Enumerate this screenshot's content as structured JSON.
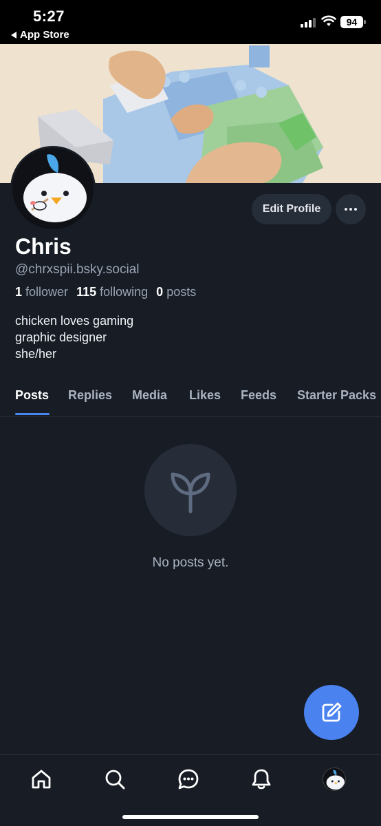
{
  "status_bar": {
    "time": "5:27",
    "back_label": "App Store",
    "battery": "94"
  },
  "profile": {
    "display_name": "Chris",
    "handle": "@chrxspii.bsky.social",
    "stats": {
      "followers_count": "1",
      "followers_label": "follower",
      "following_count": "115",
      "following_label": "following",
      "posts_count": "0",
      "posts_label": "posts"
    },
    "bio_lines": [
      "chicken loves gaming",
      "graphic designer",
      "she/her"
    ],
    "edit_label": "Edit Profile",
    "more_icon": "ellipsis-icon"
  },
  "tabs": [
    {
      "label": "Posts",
      "active": true
    },
    {
      "label": "Replies",
      "active": false
    },
    {
      "label": "Media",
      "active": false
    },
    {
      "label": "Likes",
      "active": false
    },
    {
      "label": "Feeds",
      "active": false
    },
    {
      "label": "Starter Packs",
      "active": false
    }
  ],
  "empty_state": {
    "icon": "sprout-icon",
    "message": "No posts yet."
  },
  "fab_icon": "compose-icon",
  "bottom_nav": [
    "home-icon",
    "search-icon",
    "chat-icon",
    "bell-icon",
    "profile-avatar"
  ],
  "colors": {
    "background": "#171c25",
    "accent": "#4a82f0",
    "muted_text": "#9aa4b3",
    "button_bg": "#262e3a"
  }
}
